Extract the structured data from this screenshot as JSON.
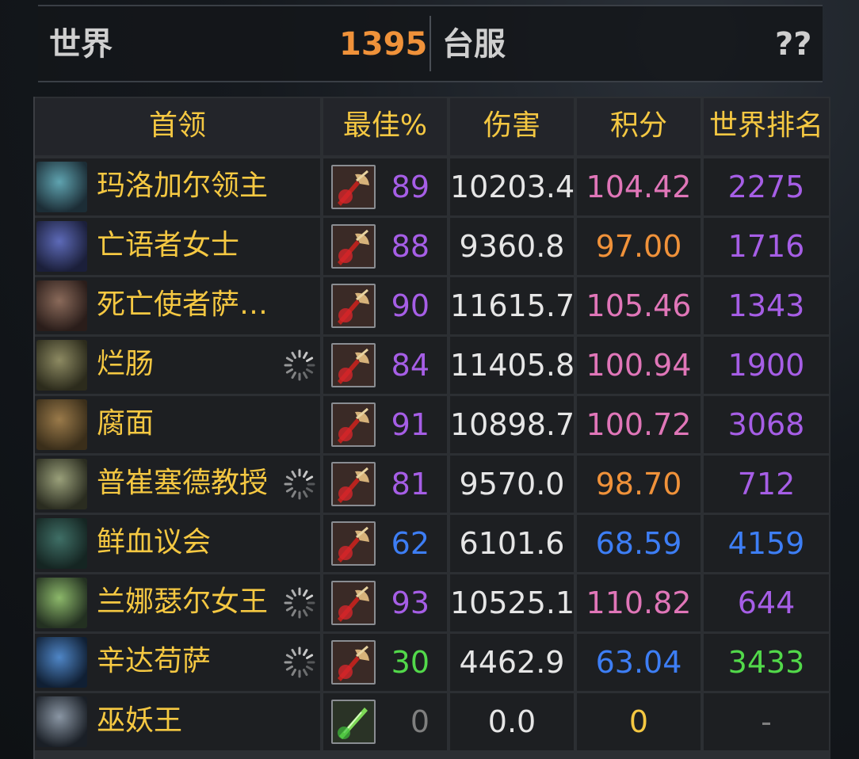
{
  "header": {
    "world_label": "世界",
    "world_value": "1395",
    "region_label": "台服",
    "region_value": "??"
  },
  "columns": [
    "首领",
    "最佳%",
    "伤害",
    "积分",
    "世界排名"
  ],
  "colors": {
    "gold": "#f5c842",
    "purple": "#a65ee6",
    "pink": "#e076b8",
    "orange": "#f0923a",
    "blue": "#3d7ef5",
    "green": "#52d94a",
    "gray": "#7f7f7f",
    "white": "#e6e6e6"
  },
  "rows": [
    {
      "boss": "玛洛加尔领主",
      "avatar": "lord-marrowgar",
      "spinner": false,
      "spell": "axe",
      "best": "89",
      "best_color": "purple",
      "damage": "10203.4",
      "score": "104.42",
      "score_color": "pink",
      "rank": "2275",
      "rank_color": "purple"
    },
    {
      "boss": "亡语者女士",
      "avatar": "lady-deathwhisper",
      "spinner": false,
      "spell": "axe",
      "best": "88",
      "best_color": "purple",
      "damage": "9360.8",
      "score": "97.00",
      "score_color": "orange",
      "rank": "1716",
      "rank_color": "purple"
    },
    {
      "boss": "死亡使者萨…",
      "avatar": "deathbringer-saurfang",
      "spinner": false,
      "spell": "axe",
      "best": "90",
      "best_color": "purple",
      "damage": "11615.7",
      "score": "105.46",
      "score_color": "pink",
      "rank": "1343",
      "rank_color": "purple"
    },
    {
      "boss": "烂肠",
      "avatar": "festergut",
      "spinner": true,
      "spell": "axe",
      "best": "84",
      "best_color": "purple",
      "damage": "11405.8",
      "score": "100.94",
      "score_color": "pink",
      "rank": "1900",
      "rank_color": "purple"
    },
    {
      "boss": "腐面",
      "avatar": "rotface",
      "spinner": false,
      "spell": "axe",
      "best": "91",
      "best_color": "purple",
      "damage": "10898.7",
      "score": "100.72",
      "score_color": "pink",
      "rank": "3068",
      "rank_color": "purple"
    },
    {
      "boss": "普崔塞德教授",
      "avatar": "professor-putricide",
      "spinner": true,
      "spell": "axe",
      "best": "81",
      "best_color": "purple",
      "damage": "9570.0",
      "score": "98.70",
      "score_color": "orange",
      "rank": "712",
      "rank_color": "purple"
    },
    {
      "boss": "鲜血议会",
      "avatar": "blood-council",
      "spinner": false,
      "spell": "axe",
      "best": "62",
      "best_color": "blue",
      "damage": "6101.6",
      "score": "68.59",
      "score_color": "blue",
      "rank": "4159",
      "rank_color": "blue"
    },
    {
      "boss": "兰娜瑟尔女王",
      "avatar": "blood-queen-lanathel",
      "spinner": true,
      "spell": "axe",
      "best": "93",
      "best_color": "purple",
      "damage": "10525.1",
      "score": "110.82",
      "score_color": "pink",
      "rank": "644",
      "rank_color": "purple"
    },
    {
      "boss": "辛达苟萨",
      "avatar": "sindragosa",
      "spinner": true,
      "spell": "axe",
      "best": "30",
      "best_color": "green",
      "damage": "4462.9",
      "score": "63.04",
      "score_color": "blue",
      "rank": "3433",
      "rank_color": "green"
    },
    {
      "boss": "巫妖王",
      "avatar": "lich-king",
      "spinner": false,
      "spell": "green-blade",
      "best": "0",
      "best_color": "gray",
      "damage": "0.0",
      "score": "0",
      "score_color": "gold",
      "rank": "-",
      "rank_color": "gray"
    }
  ]
}
